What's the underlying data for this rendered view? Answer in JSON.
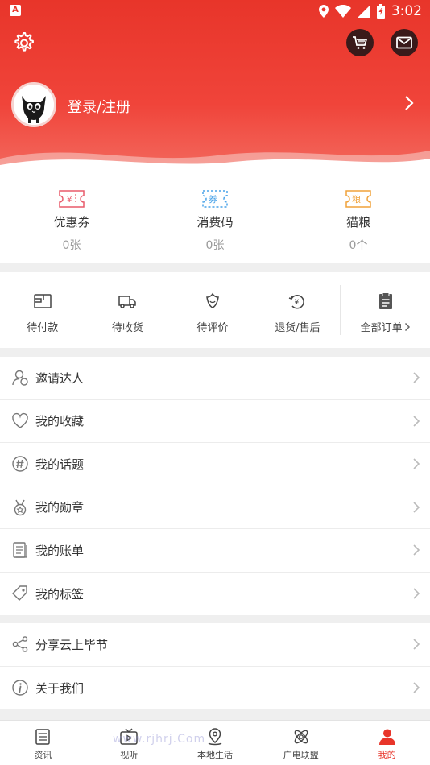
{
  "status_bar": {
    "time": "3:02"
  },
  "header": {
    "login_label": "登录/注册"
  },
  "coupons": [
    {
      "title": "优惠券",
      "count": "0张",
      "icon": "coupon-icon"
    },
    {
      "title": "消费码",
      "count": "0张",
      "icon": "voucher-icon"
    },
    {
      "title": "猫粮",
      "count": "0个",
      "icon": "cat-food-icon"
    }
  ],
  "orders": [
    {
      "label": "待付款",
      "icon": "wallet-icon"
    },
    {
      "label": "待收货",
      "icon": "truck-icon"
    },
    {
      "label": "待评价",
      "icon": "review-icon"
    },
    {
      "label": "退货/售后",
      "icon": "refund-icon"
    },
    {
      "label": "全部订单",
      "icon": "clipboard-icon"
    }
  ],
  "menu_group1": [
    {
      "label": "邀请达人",
      "icon": "invite-user-icon"
    },
    {
      "label": "我的收藏",
      "icon": "heart-icon"
    },
    {
      "label": "我的话题",
      "icon": "hashtag-icon"
    },
    {
      "label": "我的勋章",
      "icon": "medal-icon"
    },
    {
      "label": "我的账单",
      "icon": "bill-icon"
    },
    {
      "label": "我的标签",
      "icon": "tag-icon"
    }
  ],
  "menu_group2": [
    {
      "label": "分享云上毕节",
      "icon": "share-icon"
    },
    {
      "label": "关于我们",
      "icon": "info-icon"
    }
  ],
  "tabs": [
    {
      "label": "资讯",
      "icon": "news-icon"
    },
    {
      "label": "视听",
      "icon": "tv-icon"
    },
    {
      "label": "本地生活",
      "icon": "location-icon"
    },
    {
      "label": "广电联盟",
      "icon": "atom-icon"
    },
    {
      "label": "我的",
      "icon": "user-icon",
      "active": true
    }
  ],
  "watermark": "www.rjhrj.Com",
  "colors": {
    "accent": "#e8352a",
    "coupon_red": "#e85a6a",
    "coupon_blue": "#4aa3e8",
    "coupon_orange": "#f0a23a"
  }
}
